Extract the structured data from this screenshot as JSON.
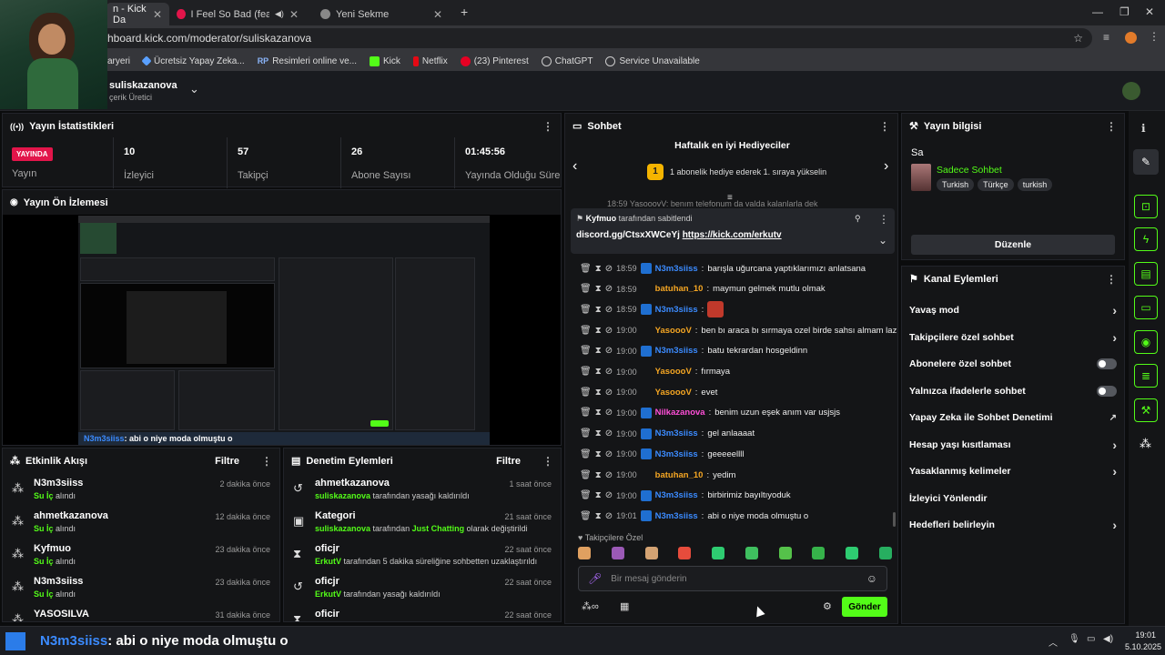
{
  "tabs": [
    {
      "label": "n - Kick Da",
      "active": true
    },
    {
      "label": "I Feel So Bad (feat. Epheme",
      "active": false
    },
    {
      "label": "Yeni Sekme",
      "active": false
    }
  ],
  "url": "hboard.kick.com/moderator/suliskazanova",
  "bookmarks": [
    "aryeri",
    "Ücretsiz Yapay Zeka...",
    "Resimleri online ve...",
    "Kick",
    "Netflix",
    "(23) Pinterest",
    "ChatGPT",
    "Service Unavailable"
  ],
  "channel": {
    "name": "suliskazanova",
    "role": "çerik Üretici"
  },
  "stats": {
    "title": "Yayın İstatistikleri",
    "live_badge": "YAYINDA",
    "live_label": "Yayın",
    "items": [
      {
        "value": "10",
        "label": "İzleyici"
      },
      {
        "value": "57",
        "label": "Takipçi"
      },
      {
        "value": "26",
        "label": "Abone Sayısı"
      },
      {
        "value": "01:45:56",
        "label": "Yayında Olduğu Süre"
      }
    ]
  },
  "preview": {
    "title": "Yayın Ön İzlemesi",
    "caption": "abi o niye moda olmuştu o"
  },
  "activity": {
    "title": "Etkinlik Akışı",
    "filter": "Filtre",
    "items": [
      {
        "name": "N3m3siiss",
        "sub": "Su İç",
        "action": "alındı",
        "time": "2 dakika önce"
      },
      {
        "name": "ahmetkazanova",
        "sub": "Su İç",
        "action": "alındı",
        "time": "12 dakika önce"
      },
      {
        "name": "Kyfmuo",
        "sub": "Su İç",
        "action": "alındı",
        "time": "23 dakika önce"
      },
      {
        "name": "N3m3siiss",
        "sub": "Su İç",
        "action": "alındı",
        "time": "23 dakika önce"
      },
      {
        "name": "YASOSILVA",
        "sub": "",
        "action": "",
        "time": "31 dakika önce"
      }
    ]
  },
  "moderation": {
    "title": "Denetim Eylemleri",
    "filter": "Filtre",
    "items": [
      {
        "name": "ahmetkazanova",
        "who": "suliskazanova",
        "rest": "tarafından yasağı kaldırıldı",
        "extra": "",
        "extra_rest": "",
        "time": "1 saat önce"
      },
      {
        "name": "Kategori",
        "who": "suliskazanova",
        "rest": "tarafından",
        "extra": "Just Chatting",
        "extra_rest": "olarak değiştirildi",
        "time": "21 saat önce"
      },
      {
        "name": "oficjr",
        "who": "ErkutV",
        "rest": "tarafından 5 dakika süreliğine sohbetten uzaklaştırıldı",
        "extra": "",
        "extra_rest": "",
        "time": "22 saat önce"
      },
      {
        "name": "oficjr",
        "who": "ErkutV",
        "rest": "tarafından yasağı kaldırıldı",
        "extra": "",
        "extra_rest": "",
        "time": "22 saat önce"
      },
      {
        "name": "oficir",
        "who": "",
        "rest": "",
        "extra": "",
        "extra_rest": "",
        "time": "22 saat önce"
      }
    ]
  },
  "chat": {
    "title": "Sohbet",
    "gifters_title": "Haftalık en iyi Hediyeciler",
    "gifters_text": "1 abonelik hediye ederek 1. sıraya yükselin",
    "gifters_rank": "1",
    "pinned_by": "Kyfmuo",
    "pinned_by_rest": "tarafından sabitlendi",
    "pinned_msg": "discord.gg/CtsxXWCeYj",
    "pinned_link": "https://kick.com/erkutv",
    "partial_line": "18:59 YasooovV: benım telefonum da valda kalanlarla dek",
    "messages": [
      {
        "time": "18:59",
        "user": "N3m3siiss",
        "color": "#3b8bff",
        "text": "barışla uğurcana yaptıklarımızı anlatsana"
      },
      {
        "time": "18:59",
        "user": "batuhan_10",
        "color": "#f5a623",
        "text": "maymun gelmek mutlu olmak"
      },
      {
        "time": "18:59",
        "user": "N3m3siiss",
        "color": "#3b8bff",
        "text": ""
      },
      {
        "time": "19:00",
        "user": "YasoooV",
        "color": "#f5a623",
        "text": "ben bı araca bı sırmaya ozel birde sahsı almam lazım"
      },
      {
        "time": "19:00",
        "user": "N3m3siiss",
        "color": "#3b8bff",
        "text": "batu tekrardan hosgeldinn"
      },
      {
        "time": "19:00",
        "user": "YasoooV",
        "color": "#f5a623",
        "text": "fırmaya"
      },
      {
        "time": "19:00",
        "user": "YasoooV",
        "color": "#f5a623",
        "text": "evet"
      },
      {
        "time": "19:00",
        "user": "Nilkazanova",
        "color": "#ff4fd8",
        "text": "benim uzun eşek anım var usjsjs"
      },
      {
        "time": "19:00",
        "user": "N3m3siiss",
        "color": "#3b8bff",
        "text": "gel anlaaaat"
      },
      {
        "time": "19:00",
        "user": "N3m3siiss",
        "color": "#3b8bff",
        "text": "geeeeellll"
      },
      {
        "time": "19:00",
        "user": "batuhan_10",
        "color": "#f5a623",
        "text": "yedim"
      },
      {
        "time": "19:00",
        "user": "N3m3siiss",
        "color": "#3b8bff",
        "text": "birbirimiz bayıltıyoduk"
      },
      {
        "time": "19:01",
        "user": "N3m3siiss",
        "color": "#3b8bff",
        "text": "abi o niye moda olmuştu o"
      }
    ],
    "followers_only": "Takipçilere Özel",
    "input_placeholder": "Bir mesaj gönderin",
    "send": "Gönder"
  },
  "streaminfo": {
    "title": "Yayın bilgisi",
    "stream_title": "Sa",
    "category": "Sadece Sohbet",
    "tags": [
      "Turkish",
      "Türkçe",
      "turkish"
    ],
    "edit": "Düzenle"
  },
  "channel_actions": {
    "title": "Kanal Eylemleri",
    "items": [
      {
        "label": "Yavaş mod",
        "ctrl": "chevron"
      },
      {
        "label": "Takipçilere özel sohbet",
        "ctrl": "chevron"
      },
      {
        "label": "Abonelere özel sohbet",
        "ctrl": "toggle"
      },
      {
        "label": "Yalnızca ifadelerle sohbet",
        "ctrl": "toggle"
      },
      {
        "label": "Yapay Zeka ile Sohbet Denetimi",
        "ctrl": "external"
      },
      {
        "label": "Hesap yaşı kısıtlaması",
        "ctrl": "chevron"
      },
      {
        "label": "Yasaklanmış kelimeler",
        "ctrl": "chevron"
      },
      {
        "label": "İzleyici Yönlendir",
        "ctrl": "none"
      },
      {
        "label": "Hedefleri belirleyin",
        "ctrl": "chevron"
      }
    ]
  },
  "taskbar": {
    "overlay": "N3m3siiss",
    "message": ": abi o niye moda olmuştu o",
    "time": "19:01",
    "date": "5.10.2025"
  },
  "colors": {
    "accent": "#53fc18",
    "live": "#e2154a",
    "panel": "#141517"
  }
}
